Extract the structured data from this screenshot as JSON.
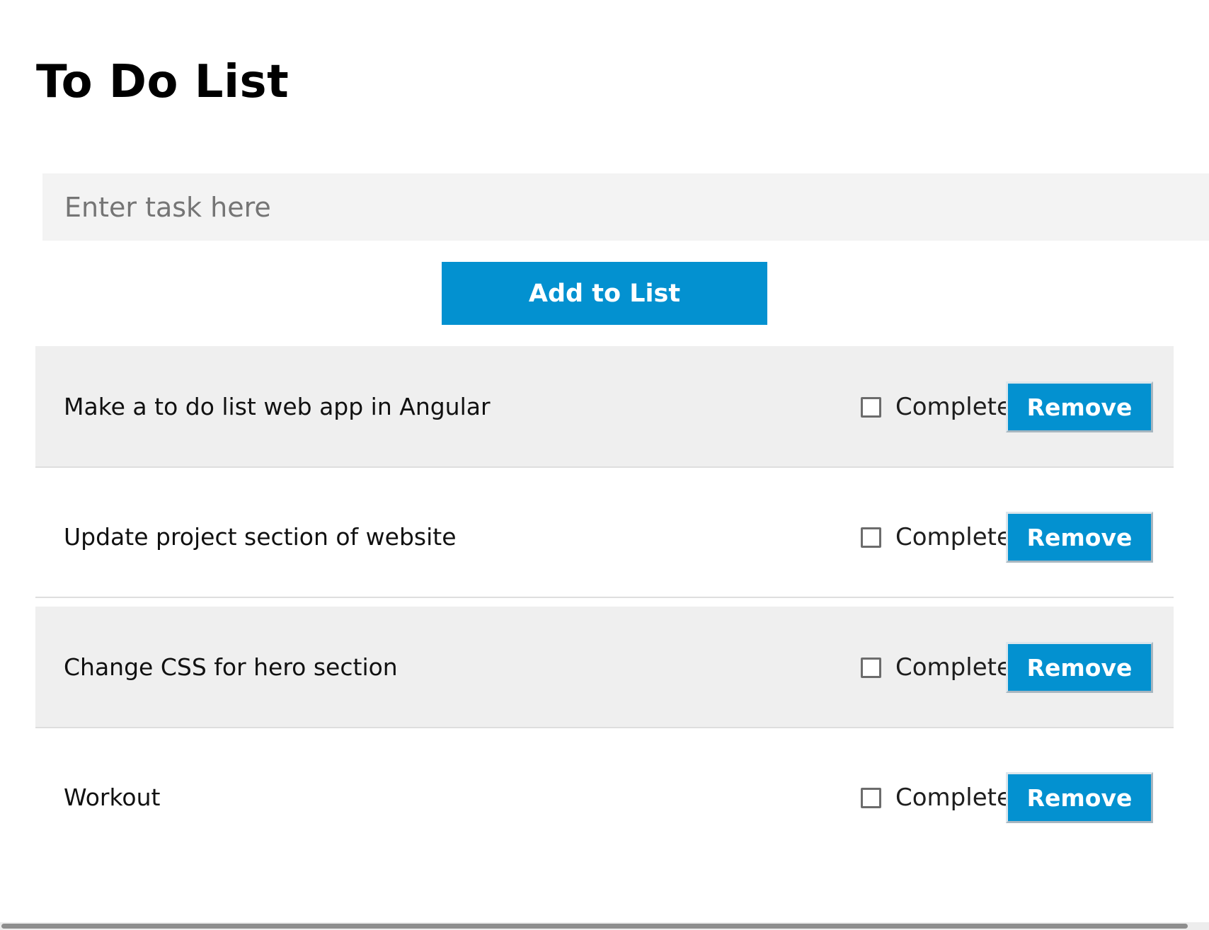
{
  "page": {
    "title": "To Do List"
  },
  "task_input": {
    "value": "",
    "placeholder": "Enter task here"
  },
  "add_button": {
    "label": "Add to List"
  },
  "todos": [
    {
      "text": "Make a to do list web app in Angular",
      "complete_label": "Complete",
      "completed": false,
      "remove_label": "Remove"
    },
    {
      "text": "Update project section of website",
      "complete_label": "Complete",
      "completed": false,
      "remove_label": "Remove"
    },
    {
      "text": "Change CSS for hero section",
      "complete_label": "Complete",
      "completed": false,
      "remove_label": "Remove"
    },
    {
      "text": "Workout",
      "complete_label": "Complete",
      "completed": false,
      "remove_label": "Remove"
    }
  ],
  "colors": {
    "accent": "#0391d0",
    "row_shade": "#efefef",
    "input_background": "#f3f3f3"
  }
}
